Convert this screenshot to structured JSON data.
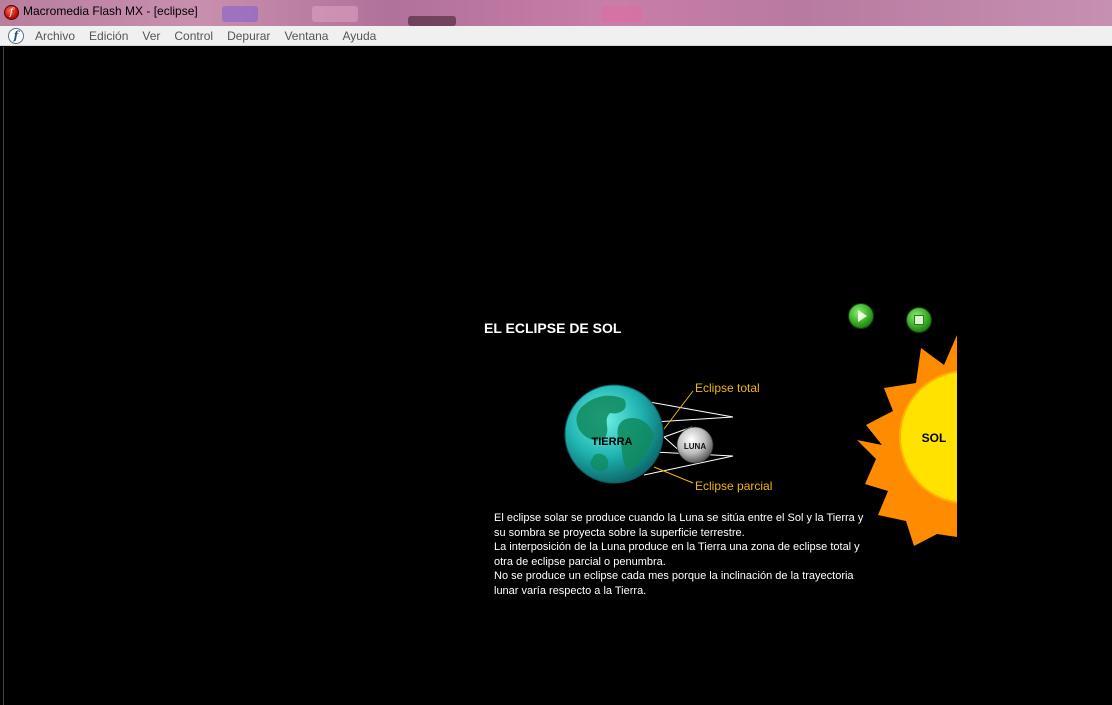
{
  "window": {
    "title": "Macromedia Flash MX - [eclipse]",
    "app_icon": "flash-icon"
  },
  "menu": {
    "logo_icon": "flash-logo-icon",
    "items": [
      "Archivo",
      "Edición",
      "Ver",
      "Control",
      "Depurar",
      "Ventana",
      "Ayuda"
    ]
  },
  "scene": {
    "title": "EL ECLIPSE DE SOL",
    "controls": {
      "play_icon": "play-icon",
      "stop_icon": "stop-icon"
    },
    "labels": {
      "earth": "TIERRA",
      "moon": "LUNA",
      "sun": "SOL",
      "total": "Eclipse total",
      "partial": "Eclipse parcial"
    },
    "colors": {
      "callout": "#f2b705",
      "sun": "#ffd400",
      "sun_rays": "#ff8c00",
      "earth_ocean": "#1fb3b0",
      "earth_land": "#0f8a5e",
      "moon": "#c0c0c0"
    },
    "description": [
      "El eclipse solar se produce cuando la Luna se sitúa entre el Sol y la Tierra y su sombra se proyecta sobre la superficie terrestre.",
      "La interposición de la Luna produce en la Tierra una zona de eclipse total y otra de eclipse parcial o penumbra.",
      "No se produce un eclipse cada mes porque la inclinación de la trayectoria lunar varía respecto a la Tierra."
    ]
  }
}
